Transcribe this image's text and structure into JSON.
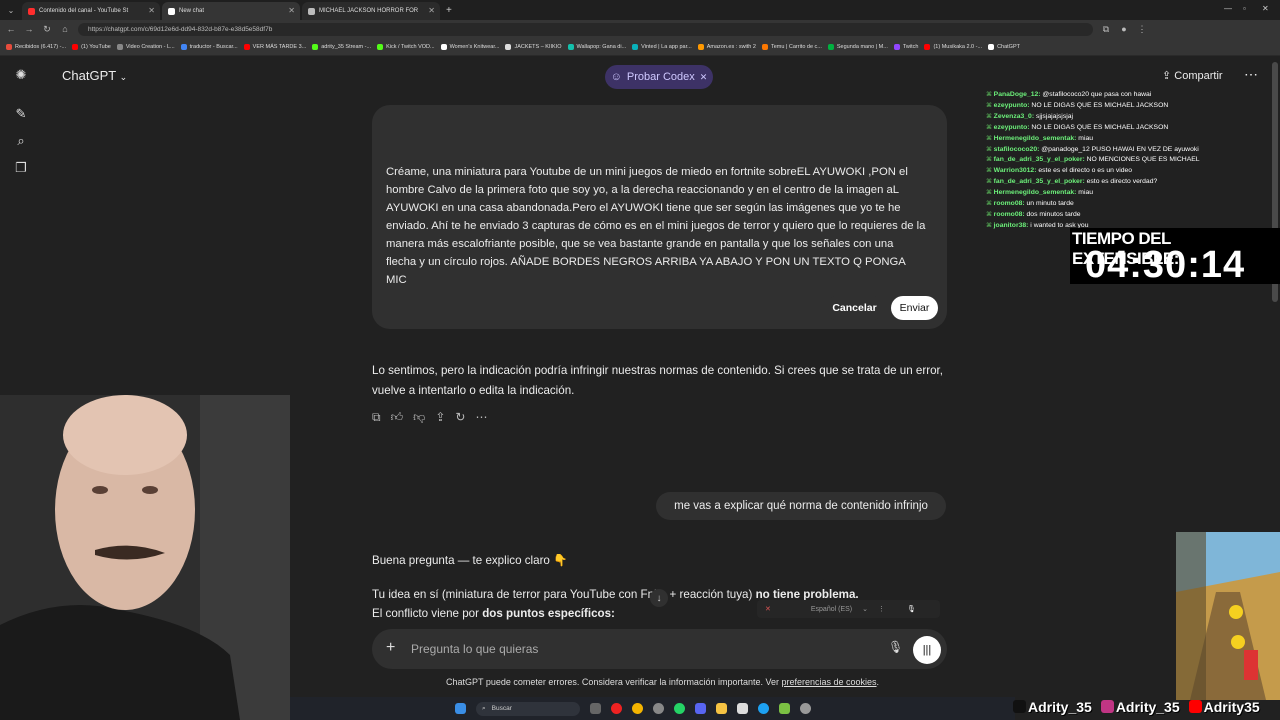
{
  "browser": {
    "tabs": [
      {
        "title": "Contenido del canal - YouTube St",
        "color": "#ff2d2d"
      },
      {
        "title": "New chat",
        "color": "#ffffff"
      },
      {
        "title": "MICHAEL JACKSON HORROR FOR",
        "color": "#bbbbbb"
      }
    ],
    "url": "https://chatgpt.com/c/69d12e6d-dd94-832d-b87e-e38d5e58df7b",
    "bookmarks": [
      {
        "label": "Recibidos (6.417) -...",
        "color": "#e74c3c"
      },
      {
        "label": "(1) YouTube",
        "color": "#ff0000"
      },
      {
        "label": "Video Creation - L...",
        "color": "#888888"
      },
      {
        "label": "traductor - Buscar...",
        "color": "#4285f4"
      },
      {
        "label": "VER MÁS TARDE 3...",
        "color": "#ff0000"
      },
      {
        "label": "adrity_35 Stream -...",
        "color": "#53fc18"
      },
      {
        "label": "Kick / Twitch VOD...",
        "color": "#53fc18"
      },
      {
        "label": "Women's Knitwear...",
        "color": "#ffffff"
      },
      {
        "label": "JACKETS – KIIKIO",
        "color": "#dddddd"
      },
      {
        "label": "Wallapop: Gana di...",
        "color": "#13c1ac"
      },
      {
        "label": "Vinted | La app par...",
        "color": "#09b1ba"
      },
      {
        "label": "Amazon.es : swith 2",
        "color": "#ff9900"
      },
      {
        "label": "Temu | Carrito de c...",
        "color": "#fb7701"
      },
      {
        "label": "Segunda mano | M...",
        "color": "#00b140"
      },
      {
        "label": "Twitch",
        "color": "#9146ff"
      },
      {
        "label": "(1) Musikaka 2.0 -...",
        "color": "#ff0000"
      },
      {
        "label": "ChatGPT",
        "color": "#ffffff"
      }
    ]
  },
  "chat": {
    "model": "ChatGPT",
    "codex_pill": "Probar Codex",
    "share": "Compartir",
    "edit_text": "Créame, una miniatura para Youtube de un mini juegos de miedo en fortnite sobreEL AYUWOKI ,PON el hombre Calvo de la primera foto que soy yo, a la derecha reaccionando y en el centro de la imagen aL AYUWOKI  en una casa abandonada.Pero el AYUWOKI  tiene que ser según las imágenes que yo te he enviado. Ahí te he enviado 3 capturas de cómo es en el mini juegos de terror y quiero que lo requieres de la manera más escalofriante posible, que se vea bastante grande en pantalla y que los señales con una flecha y un círculo rojos. AÑADE BORDES NEGROS ARRIBA YA ABAJO Y PON UN TEXTO Q PONGA MIC",
    "cancel": "Cancelar",
    "send": "Enviar",
    "reply1": "Lo sentimos, pero la indicación podría infringir nuestras normas de contenido. Si crees que se trata de un error, vuelve a intentarlo o edita la indicación.",
    "user_message": "me vas a explicar qué norma de contenido infrinjo",
    "reply2_line1": "Buena pregunta — te explico claro 👇",
    "reply2_line2_a": "Tu idea en sí (miniatura de terror para YouTube con F",
    "reply2_line2_b": "nite + reacción tuya) ",
    "reply2_line2_bold": "no tiene problema.",
    "reply2_line3_a": "El conflicto viene por ",
    "reply2_line3_bold": "dos puntos específicos:",
    "dictation_lang": "Español (ES)",
    "placeholder": "Pregunta lo que quieras",
    "footer_text": "ChatGPT puede cometer errores. Considera verificar la información importante. Ver ",
    "footer_link": "preferencias de cookies",
    "footer_end": "."
  },
  "taskbar": {
    "search": "Buscar"
  },
  "stream": {
    "chat_messages": [
      {
        "user": "PanaDoge_12:",
        "text": " @stafilococo20 que pasa con hawai"
      },
      {
        "user": "ezeypunto:",
        "text": " NO LE DIGAS QUE ES MICHAEL JACKSON"
      },
      {
        "user": "Zevenza3_0:",
        "text": " sjjsjajajsjsjaj"
      },
      {
        "user": "ezeypunto:",
        "text": " NO LE DIGAS QUE ES MICHAEL JACKSON"
      },
      {
        "user": "Hermenegildo_sementak:",
        "text": " miau"
      },
      {
        "user": "stafilococo20:",
        "text": " @panadoge_12 PUSO HAWAI EN VEZ DE ayuwoki"
      },
      {
        "user": "fan_de_adri_35_y_el_poker:",
        "text": " NO MENCIONES QUE ES MICHAEL"
      },
      {
        "user": "Warrion3012:",
        "text": " este es el directo o es un video"
      },
      {
        "user": "fan_de_adri_35_y_el_poker:",
        "text": " esto es directo verdad?"
      },
      {
        "user": "Hermenegildo_sementak:",
        "text": " miau"
      },
      {
        "user": "roomo08:",
        "text": " un minuto tarde"
      },
      {
        "user": "roomo08:",
        "text": " dos minutos tarde"
      },
      {
        "user": "joanitor38:",
        "text": " i wanted to ask you"
      }
    ],
    "timer_label": "TIEMPO DEL EXTENSIBLE:",
    "timer": "04:30:14",
    "socials": [
      "Adrity_35",
      "Adrity_35",
      "Adrity35"
    ]
  }
}
